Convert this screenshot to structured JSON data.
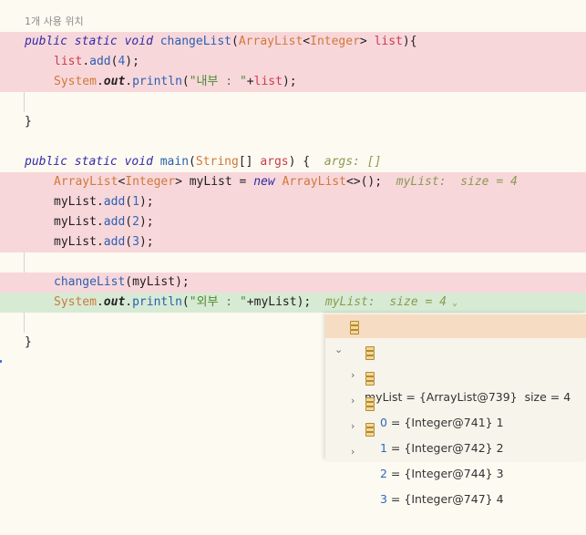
{
  "usage_label": "1개 사용 위치",
  "code": {
    "l1": {
      "kw1": "public",
      "kw2": "static",
      "kw3": "void",
      "fn": "changeList",
      "p1": "(",
      "ty1": "ArrayList",
      "lt": "<",
      "ty2": "Integer",
      "gt": ">",
      "sp": " ",
      "pa": "list",
      "p2": "){"
    },
    "l2": {
      "pa": "list",
      "dot": ".",
      "me": "add",
      "p1": "(",
      "num": "4",
      "p2": ");"
    },
    "l3": {
      "ty": "System",
      "dot1": ".",
      "sf": "out",
      "dot2": ".",
      "me": "println",
      "p1": "(",
      "st": "\"내부 : \"",
      "plus": "+",
      "pa": "list",
      "p2": ");"
    },
    "l5": {
      "brace": "}"
    },
    "l7": {
      "kw1": "public",
      "kw2": "static",
      "kw3": "void",
      "fn": "main",
      "p1": "(",
      "ty": "String",
      "arr": "[]",
      "sp": " ",
      "pa": "args",
      "p2": ") {",
      "hint": "args: []"
    },
    "l8": {
      "ty1": "ArrayList",
      "lt": "<",
      "ty2": "Integer",
      "gt": ">",
      "var": " myList ",
      "eq": "= ",
      "kw": "new",
      "sp": " ",
      "ty3": "ArrayList",
      "dia": "<>",
      "p": "();",
      "hint": "myList:  size = 4"
    },
    "l9": {
      "var": "myList",
      "dot": ".",
      "me": "add",
      "p1": "(",
      "num": "1",
      "p2": ");"
    },
    "l10": {
      "var": "myList",
      "dot": ".",
      "me": "add",
      "p1": "(",
      "num": "2",
      "p2": ");"
    },
    "l11": {
      "var": "myList",
      "dot": ".",
      "me": "add",
      "p1": "(",
      "num": "3",
      "p2": ");"
    },
    "l13": {
      "me": "changeList",
      "p1": "(",
      "var": "myList",
      "p2": ");"
    },
    "l14": {
      "ty": "System",
      "dot1": ".",
      "sf": "out",
      "dot2": ".",
      "me": "println",
      "p1": "(",
      "st": "\"외부 : \"",
      "plus": "+",
      "var": "myList",
      "p2": ");",
      "hint": "myList:  size = 4"
    },
    "l16": {
      "brace": "}"
    }
  },
  "popup": {
    "root": {
      "label": "myList = {ArrayList@739}  size = 4"
    },
    "items": [
      {
        "idx": "0",
        "rest": " = {Integer@741} 1"
      },
      {
        "idx": "1",
        "rest": " = {Integer@742} 2"
      },
      {
        "idx": "2",
        "rest": " = {Integer@744} 3"
      },
      {
        "idx": "3",
        "rest": " = {Integer@747} 4"
      }
    ]
  }
}
